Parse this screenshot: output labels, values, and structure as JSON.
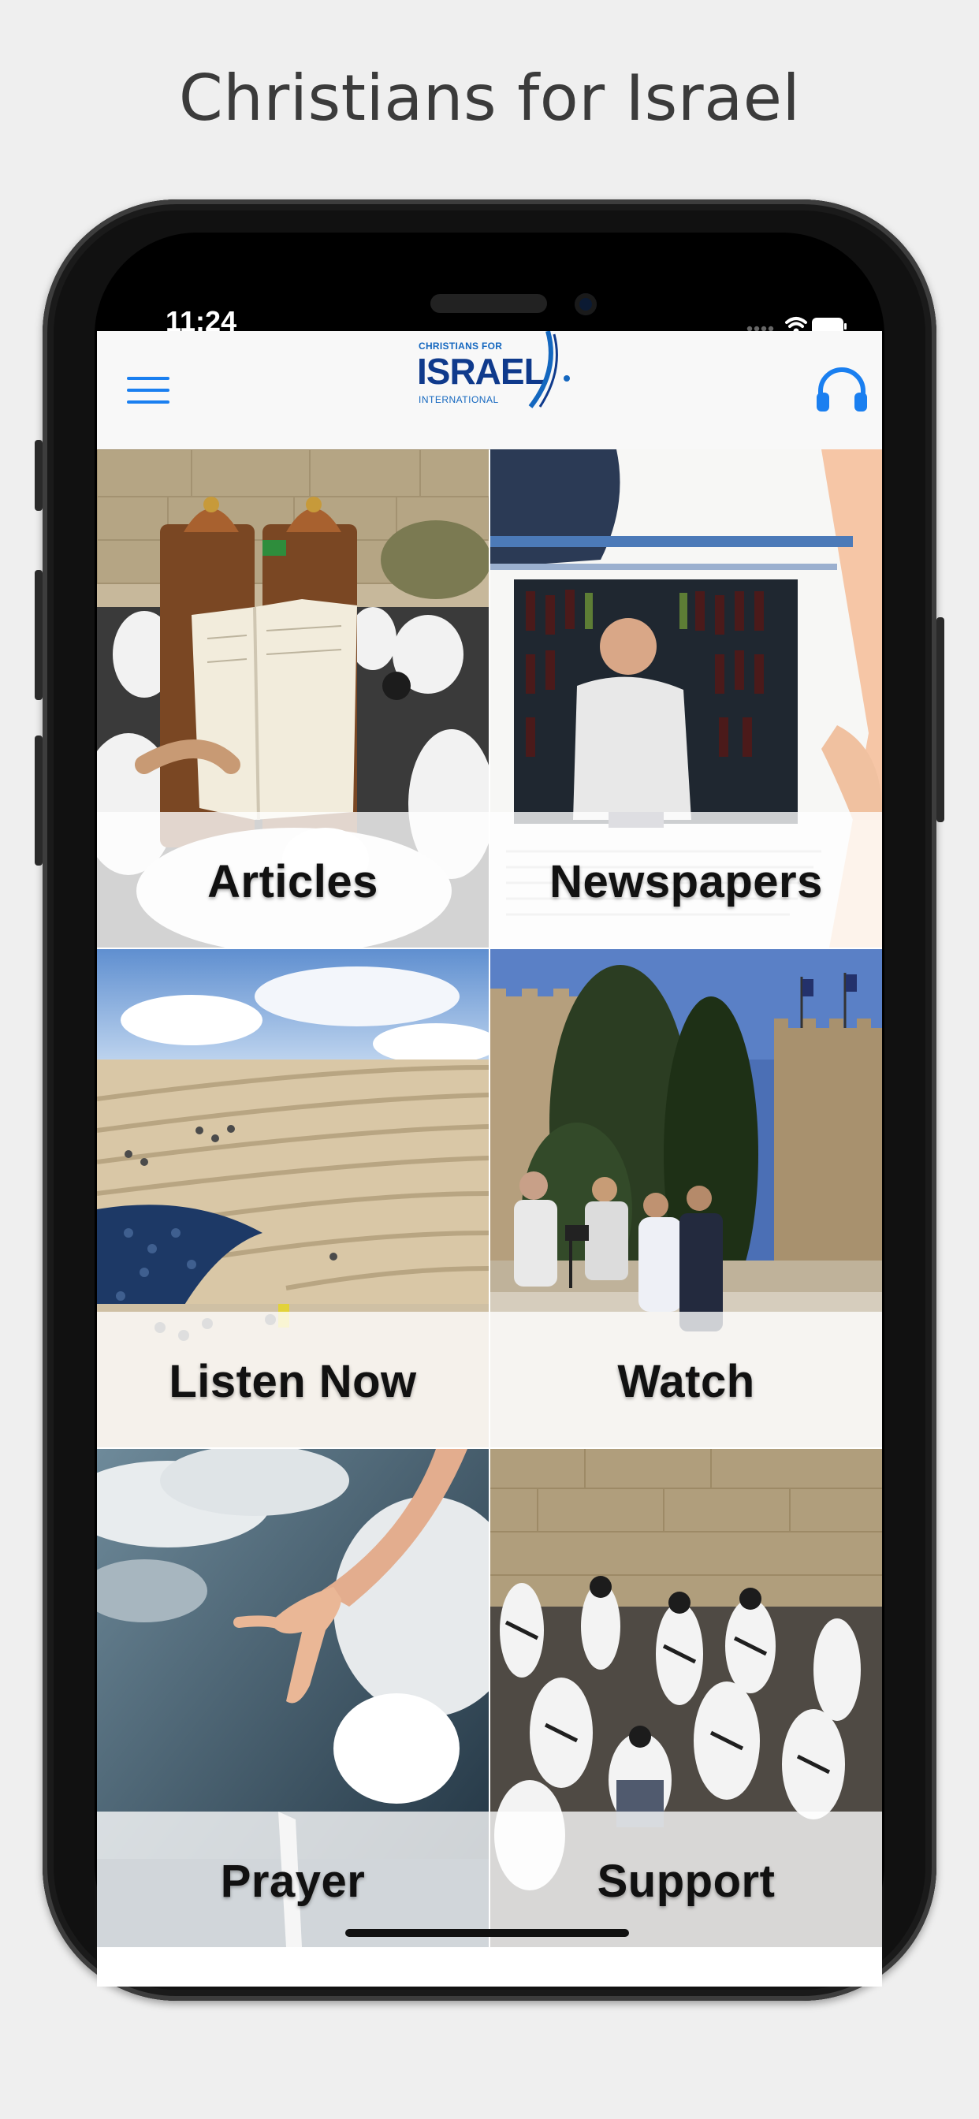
{
  "store_title": "Christians for Israel",
  "status_bar": {
    "time": "11:24"
  },
  "header": {
    "logo_small": "CHRISTIANS FOR",
    "logo_main": "ISRAEL",
    "logo_sub": "INTERNATIONAL"
  },
  "tiles": [
    {
      "label": "Articles"
    },
    {
      "label": "Newspapers"
    },
    {
      "label": "Listen Now"
    },
    {
      "label": "Watch"
    },
    {
      "label": "Prayer"
    },
    {
      "label": "Support"
    }
  ],
  "colors": {
    "accent": "#1a7ff0",
    "brand": "#0f3a8c"
  }
}
